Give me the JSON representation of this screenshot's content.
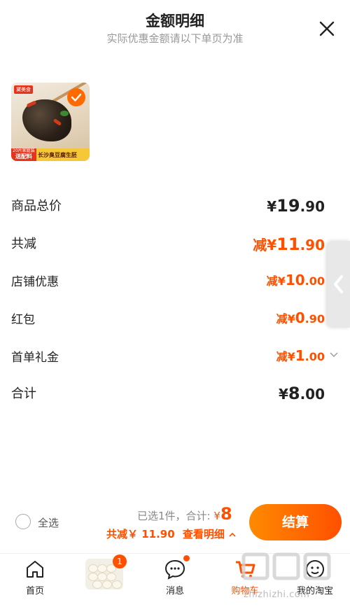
{
  "header": {
    "title": "金额明细",
    "subtitle": "实际优惠金额请以下单页为准"
  },
  "product": {
    "image_tag": "黛美食",
    "image_badge_small": "20片家庭装",
    "image_badge_big": "送配料",
    "image_name": "长沙臭豆腐生胚"
  },
  "rows": {
    "total_price": {
      "label": "商品总价",
      "currency": "¥",
      "int": "19",
      "dec": ".90"
    },
    "discount_total": {
      "label": "共减",
      "prefix": "减",
      "currency": "¥",
      "int": "11",
      "dec": ".90"
    },
    "shop_coupon": {
      "label": "店铺优惠",
      "prefix": "减",
      "currency": "¥",
      "int": "10",
      "dec": ".00"
    },
    "red_packet": {
      "label": "红包",
      "prefix": "减",
      "currency": "¥",
      "int": "0",
      "dec": ".90"
    },
    "first_order": {
      "label": "首单礼金",
      "prefix": "减",
      "currency": "¥",
      "int": "1",
      "dec": ".00"
    },
    "sum": {
      "label": "合计",
      "currency": "¥",
      "int": "8",
      "dec": ".00"
    }
  },
  "bottom": {
    "select_all": "全选",
    "selected_text": "已选1件，合计:",
    "total_currency": "¥",
    "total_value": "8",
    "discount_text": "共减￥ 11.90",
    "detail_link": "查看明细",
    "checkout": "结算"
  },
  "tabbar": {
    "home": "首页",
    "messages": "消息",
    "cart": "购物车",
    "mine": "我的淘宝",
    "promo_badge": "1"
  },
  "watermark": "zhizhizhi.com",
  "colors": {
    "accent": "#ff5000",
    "accent_light": "#ff8a00",
    "text": "#222222",
    "muted": "#999999"
  }
}
